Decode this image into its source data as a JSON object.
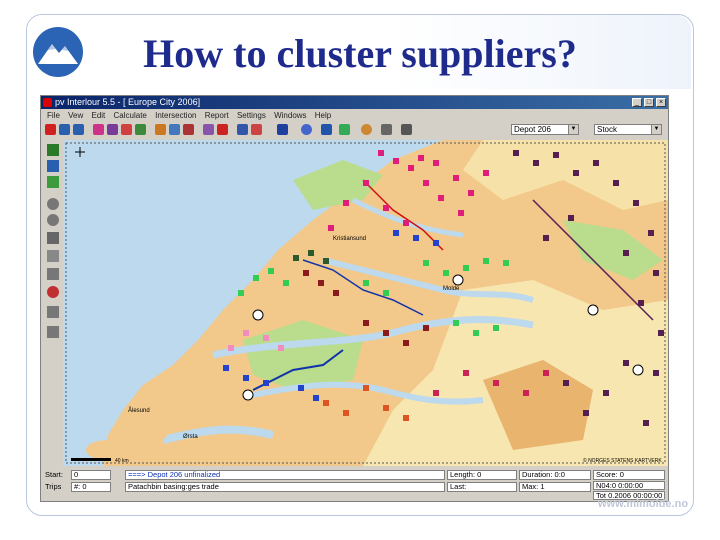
{
  "slide": {
    "title": "How to cluster suppliers?",
    "brand_url": "www.mimolde.no",
    "logo_icon": "mountain-logo-icon",
    "accent_color": "#1e2b8c"
  },
  "app": {
    "window_title": "pv Interlour 5.5 - [ Europe City 2006]",
    "menu": [
      "File",
      "Vew",
      "Edit",
      "Calculate",
      "Intersection",
      "Report",
      "Settings",
      "Windows",
      "Help"
    ],
    "combo_left": "Depot 206",
    "combo_right": "Stock"
  },
  "status": {
    "start_label": "Start:",
    "start_value": "0",
    "trips_label": "Trips",
    "trips_value": "#: 0",
    "depot_line": "===> Depot 206 unfinalized",
    "depot_sub": "Patachbin basing:ges trade",
    "length_label": "Length:",
    "length_value": "0",
    "last_label": "Last:",
    "duration_label": "Duration:",
    "duration_value": "0:0",
    "max_label": "Max:",
    "max_value": "1",
    "score_label": "Score:",
    "score_value": "0",
    "date1": "N04:0 0:00:00",
    "date2": "Tot 0.2006 00:00:00",
    "scale": "40 km",
    "credit": "© NORGES STATENS KARTVERK"
  },
  "map": {
    "places": [
      "Kristiansund",
      "Molde",
      "Ålesund",
      "Ørsta"
    ],
    "colors": {
      "sea": "#bcd9ee",
      "land_low": "#f2c98a",
      "land_mid": "#f6e2a8",
      "land_green": "#b9dd8c",
      "cluster_magenta": "#e01d7a",
      "cluster_purple": "#55204f",
      "cluster_blue": "#2244cc",
      "cluster_green": "#33cc55",
      "cluster_darkred": "#8b1a1a",
      "cluster_orange": "#dd5522",
      "route_blue": "#1133aa",
      "route_red": "#d01010"
    }
  }
}
